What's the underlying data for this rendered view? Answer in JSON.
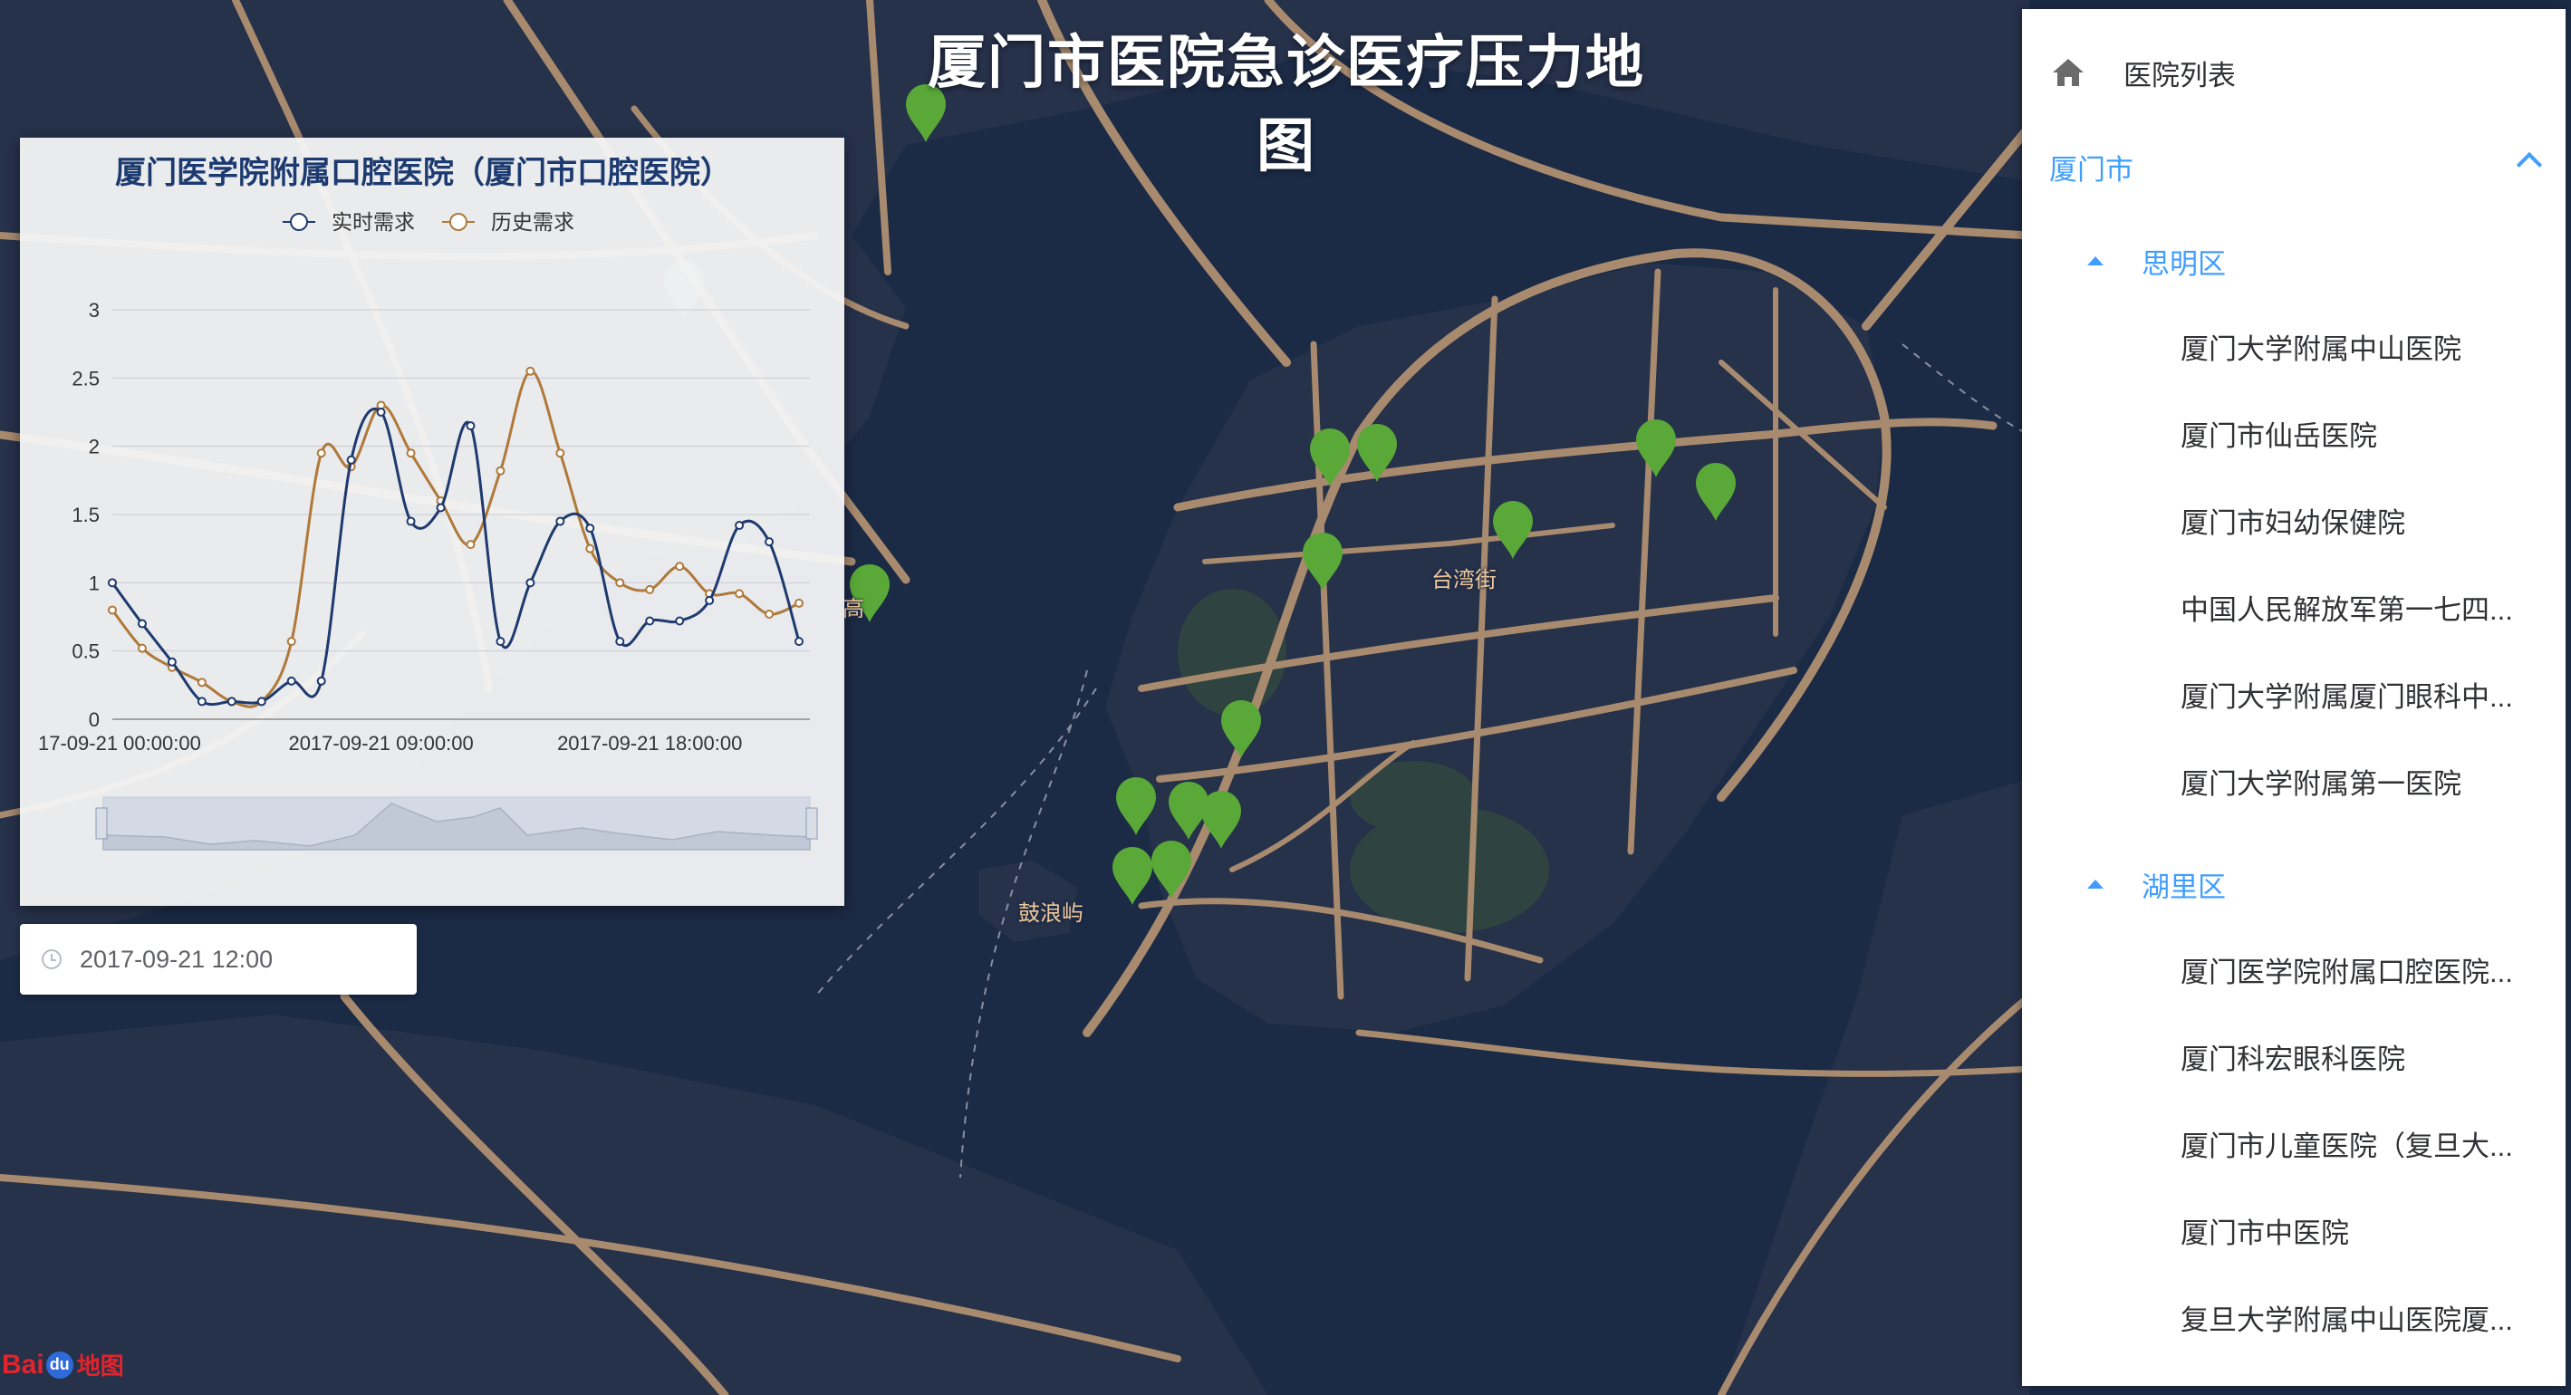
{
  "page_title": "厦门市医院急诊医疗压力地图",
  "map": {
    "place_labels": [
      "台湾街",
      "鼓浪屿",
      "高"
    ],
    "marker_color": "#5aa838",
    "road_color": "#a88a6e",
    "water_color": "#1b2a45",
    "land_color": "#263049"
  },
  "chart": {
    "title": "厦门医学院附属口腔医院（厦门市口腔医院）",
    "legend": [
      "实时需求",
      "历史需求"
    ],
    "series_colors": [
      "#1e3a6e",
      "#b0793a"
    ]
  },
  "chart_data": {
    "type": "line",
    "title": "厦门医学院附属口腔医院（厦门市口腔医院）",
    "xlabel": "",
    "ylabel": "",
    "ylim": [
      0,
      3
    ],
    "y_ticks": [
      0,
      0.5,
      1,
      1.5,
      2,
      2.5,
      3
    ],
    "x_tick_labels": [
      "17-09-21 00:00:00",
      "2017-09-21 09:00:00",
      "2017-09-21 18:00:00"
    ],
    "x": [
      "00:00",
      "01:00",
      "02:00",
      "03:00",
      "04:00",
      "05:00",
      "06:00",
      "07:00",
      "08:00",
      "09:00",
      "10:00",
      "11:00",
      "12:00",
      "13:00",
      "14:00",
      "15:00",
      "16:00",
      "17:00",
      "18:00",
      "19:00",
      "20:00",
      "21:00",
      "22:00",
      "23:00",
      "24:00"
    ],
    "series": [
      {
        "name": "实时需求",
        "color": "#1e3a6e",
        "values": [
          1.0,
          0.7,
          0.42,
          0.13,
          0.13,
          0.13,
          0.28,
          0.28,
          1.9,
          2.25,
          1.45,
          1.55,
          2.15,
          0.57,
          1.0,
          1.45,
          1.4,
          0.57,
          0.72,
          0.72,
          0.87,
          1.42,
          1.3,
          0.57
        ]
      },
      {
        "name": "历史需求",
        "color": "#b0793a",
        "values": [
          0.8,
          0.52,
          0.38,
          0.27,
          0.13,
          0.13,
          0.57,
          1.95,
          1.85,
          2.3,
          1.95,
          1.6,
          1.28,
          1.82,
          2.55,
          1.95,
          1.25,
          1.0,
          0.95,
          1.12,
          0.92,
          0.92,
          0.77,
          0.85
        ]
      }
    ]
  },
  "date_picker": {
    "value": "2017-09-21 12:00"
  },
  "panel": {
    "home_label": "医院列表",
    "city": "厦门市",
    "districts": [
      {
        "name": "思明区",
        "hospitals": [
          "厦门大学附属中山医院",
          "厦门市仙岳医院",
          "厦门市妇幼保健院",
          "中国人民解放军第一七四...",
          "厦门大学附属厦门眼科中...",
          "厦门大学附属第一医院"
        ]
      },
      {
        "name": "湖里区",
        "hospitals": [
          "厦门医学院附属口腔医院...",
          "厦门科宏眼科医院",
          "厦门市儿童医院（复旦大...",
          "厦门市中医院",
          "复旦大学附属中山医院厦..."
        ]
      }
    ]
  },
  "baidu_logo": {
    "text_1": "Bai",
    "text_2": "du",
    "text_3": "地图"
  }
}
